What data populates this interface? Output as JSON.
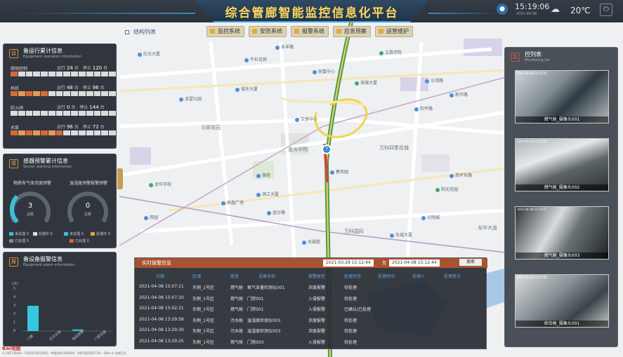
{
  "header": {
    "title": "综合管廊智能监控信息化平台",
    "time": "15:19:06",
    "date": "2021-04-08",
    "temperature": "20℃",
    "weather_icon": "cloud-sun-icon",
    "power_icon": "power-icon",
    "mic_icon": "mic-icon"
  },
  "layers": {
    "label": "结构列表"
  },
  "nav": [
    {
      "label": "监控系统"
    },
    {
      "label": "安防系统"
    },
    {
      "label": "报警系统"
    },
    {
      "label": "应急预案"
    },
    {
      "label": "运营维护"
    }
  ],
  "equipment": {
    "title": "备运行累计信息",
    "subtitle": "Equipment operation information",
    "rows": [
      {
        "name": "照明控制",
        "run_label": "运行",
        "run": "24",
        "run_unit": "台",
        "stop_label": "停止",
        "stop": "120",
        "stop_unit": "台",
        "on": 1
      },
      {
        "name": "风机",
        "run_label": "运行",
        "run": "48",
        "run_unit": "台",
        "stop_label": "停止",
        "stop": "96",
        "stop_unit": "台",
        "on": 5
      },
      {
        "name": "防火阀",
        "run_label": "运行",
        "run": "0",
        "run_unit": "台",
        "stop_label": "停止",
        "stop": "144",
        "stop_unit": "台",
        "on": 0
      },
      {
        "name": "水泵",
        "run_label": "运行",
        "run": "96",
        "run_unit": "台",
        "stop_label": "停止",
        "stop": "72",
        "stop_unit": "台",
        "on": 7
      }
    ]
  },
  "sensor": {
    "title": "感器预警累计信息",
    "subtitle": "Sensor warning information",
    "gauge1": {
      "label": "物质有气体浓度预警",
      "value": "3",
      "unit": "总数",
      "fraction": 0.33
    },
    "gauge2": {
      "label": "温湿度预警报警预警",
      "value": "0",
      "unit": "总数",
      "fraction": 0
    },
    "legend1": [
      {
        "label": "未处理 3",
        "color": "#3ac0d8"
      },
      {
        "label": "处理中 0",
        "color": "#e0e0e0"
      },
      {
        "label": "已处理 0",
        "color": "#7d8a96"
      }
    ],
    "legend2": [
      {
        "label": "未处理 0",
        "color": "#3ac0d8"
      },
      {
        "label": "处理中 0",
        "color": "#e0a040"
      },
      {
        "label": "已处理 0",
        "color": "#d76a38"
      }
    ]
  },
  "alarm_info": {
    "title": "备设备报警信息",
    "subtitle": "Equipment alarm information",
    "chart_data": {
      "type": "bar",
      "ylabel": "(次)",
      "yticks": [
        "5",
        "4",
        "3",
        "2",
        "1",
        "0"
      ],
      "ylim": [
        0,
        5
      ],
      "categories": [
        "门禁",
        "红外对射",
        "电缆报警",
        "门禁设备"
      ],
      "values": [
        3,
        0,
        0.2,
        0
      ]
    }
  },
  "alarm_table": {
    "title": "实时报警信息",
    "date_from": "2021-03-29 15:12:44",
    "date_sep": "至",
    "date_to": "2021-04-08 15:12:44",
    "search_label": "搜索",
    "columns": [
      "日期",
      "区域",
      "舱室",
      "设备名称",
      "报警类型",
      "处理状态",
      "处理时间",
      "处理人",
      "处理意见"
    ],
    "rows": [
      [
        "2021-04-08 15:07:11",
        "东侧_1号区",
        "燃气舱",
        "氧气含量检测仪001",
        "浓度报警",
        "待处理"
      ],
      [
        "2021-04-08 15:07:10",
        "东侧_1号区",
        "燃气舱",
        "门禁001",
        "入侵报警",
        "待处理"
      ],
      [
        "2021-04-08 15:02:31",
        "东侧_1号区",
        "燃气舱",
        "门禁001",
        "入侵报警",
        "已确认/已处理"
      ],
      [
        "2021-04-08 13:29:58",
        "东侧_1号区",
        "污水舱",
        "温湿度检测仪003",
        "浓度报警",
        "待处理"
      ],
      [
        "2021-04-08 13:29:30",
        "东侧_1号区",
        "污水舱",
        "温湿度检测仪003",
        "浓度报警",
        "待处理"
      ],
      [
        "2021-04-08 13:29:25",
        "东侧_1号区",
        "燃气舱",
        "门禁003",
        "入侵报警",
        "待处理"
      ]
    ]
  },
  "cameras": {
    "title": "控列表",
    "subtitle": "Monitoring list",
    "items": [
      {
        "caption": "燃气舱_摄像头001",
        "ts": "2021-04-08 15:12:06"
      },
      {
        "caption": "燃气舱_摄像头002",
        "ts": "2021-04-08 15:12:06"
      },
      {
        "caption": "燃气舱_摄像头003",
        "ts": "2021-04-08 15:12:07"
      },
      {
        "caption": "综合舱_摄像头001",
        "ts": "2021-04-08 15:12:06"
      }
    ]
  },
  "map": {
    "labels": [
      "红光大厦",
      "永丰路",
      "牛栏花苑",
      "财富中心",
      "文昌学院",
      "城东大厦",
      "马家花园",
      "龙望公园",
      "海城大厦",
      "沙湾路",
      "金光华院",
      "新华路",
      "文体中心",
      "和平路",
      "万科四季花城",
      "春风园",
      "锦苑",
      "滨江大厦",
      "凤凰广场",
      "龙华学校",
      "光明城",
      "万科国际",
      "东城大厦",
      "西园",
      "金沙路",
      "南坪东路",
      "阳光花园",
      "天福苑",
      "龙华大道"
    ],
    "copyright": "© 2021 Baidu - GS(2019)5218号 - 甲测资字1100930 - 京ICP证030173号 - Data © 长地万方",
    "logo": "Bai地图",
    "marker_icon": "map-marker-icon"
  }
}
